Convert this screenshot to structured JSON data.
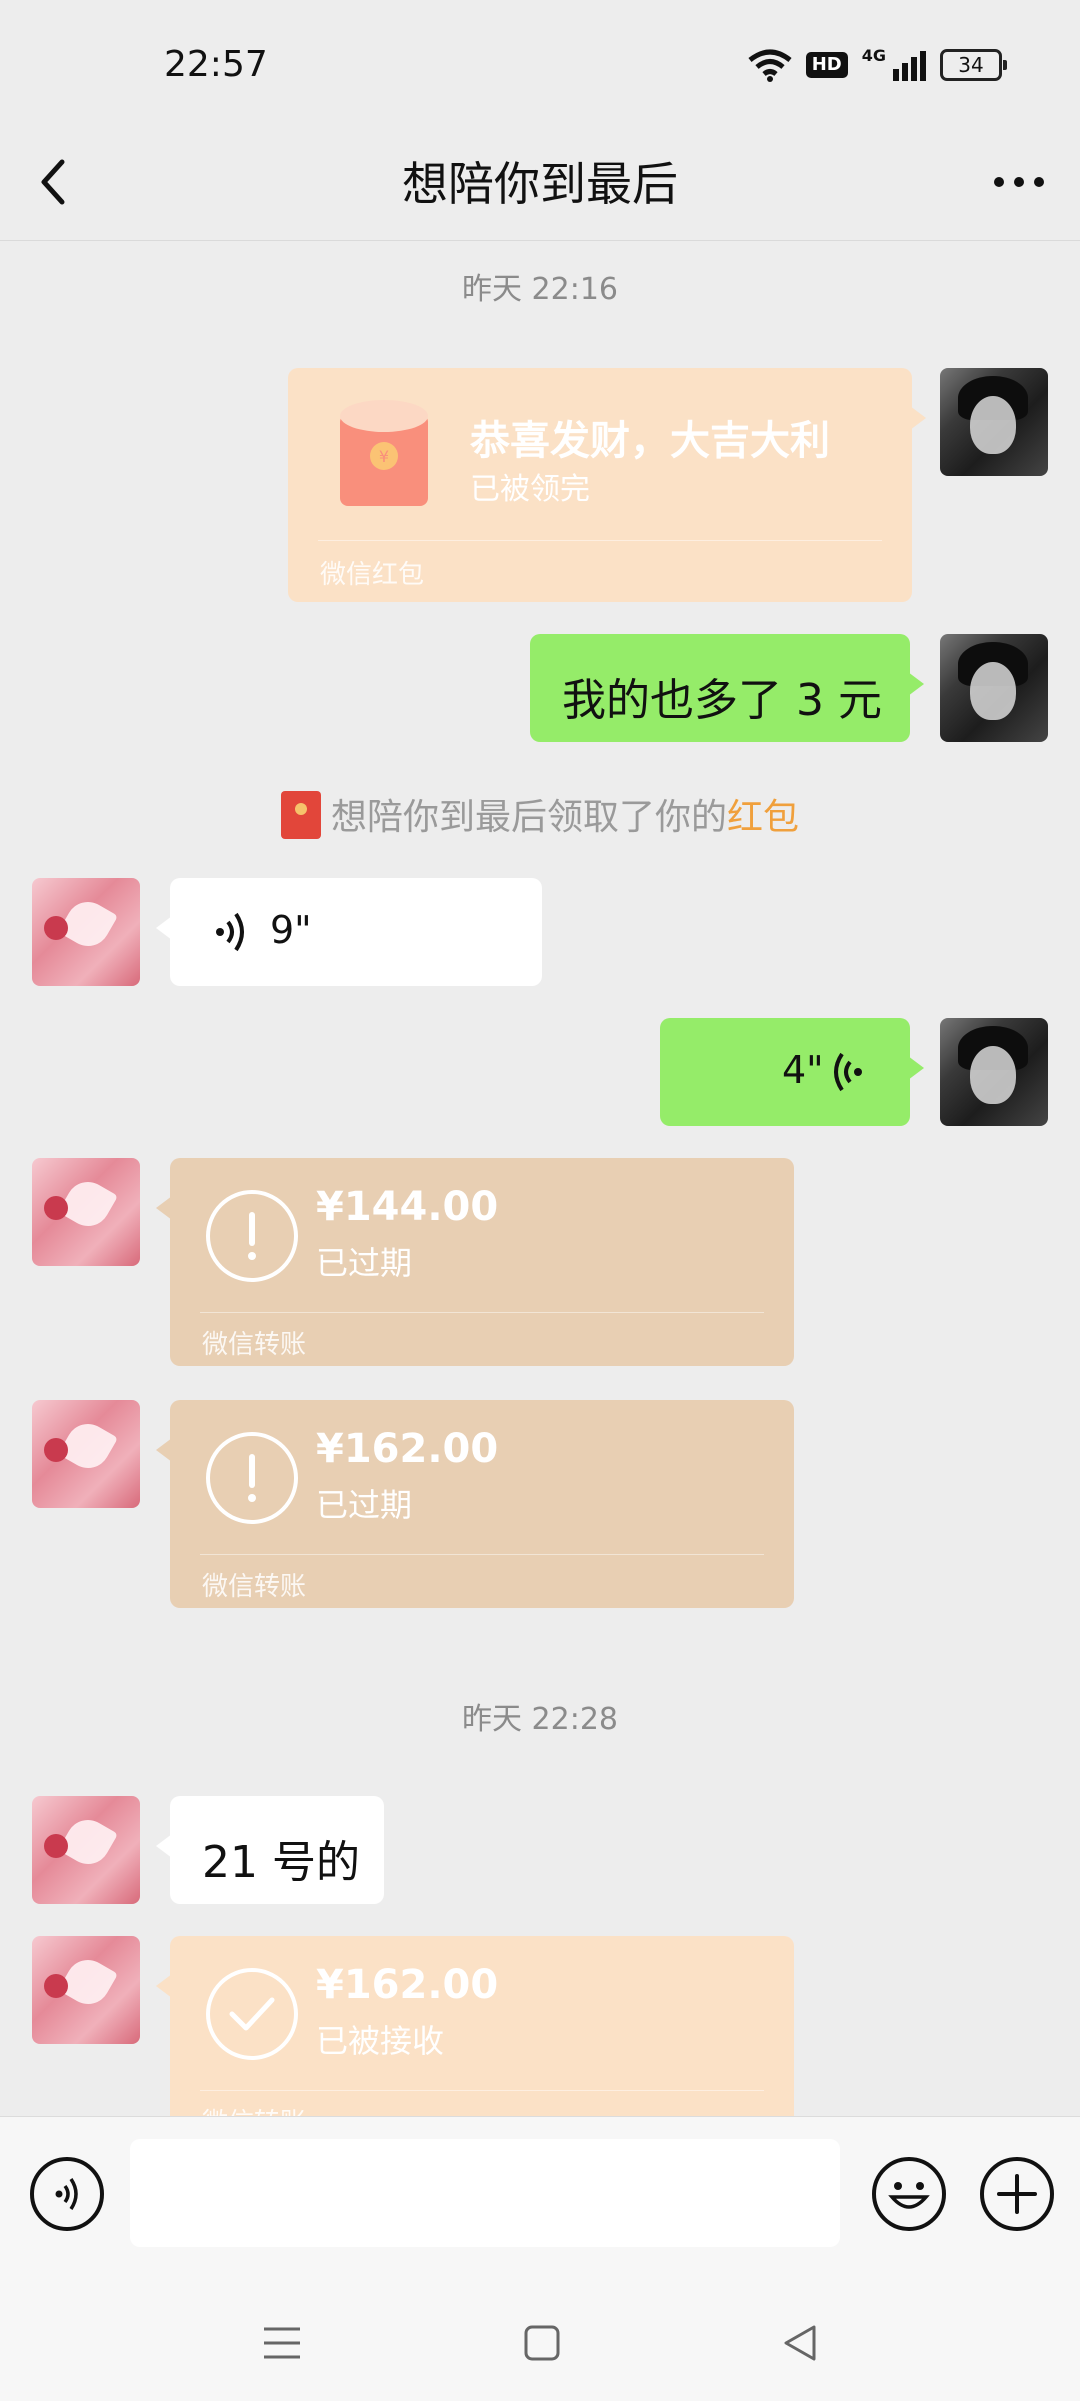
{
  "status_bar": {
    "time": "22:57",
    "hd": "HD",
    "network": "4G",
    "battery": "34"
  },
  "header": {
    "title": "想陪你到最后"
  },
  "messages": {
    "stamp1": "昨天 22:16",
    "redpacket": {
      "title": "恭喜发财，大吉大利",
      "status": "已被领完",
      "footer": "微信红包"
    },
    "me_text": "我的也多了 3 元",
    "system": {
      "prefix": "想陪你到最后领取了你的",
      "highlight": "红包"
    },
    "voice_in": {
      "duration": "9\""
    },
    "voice_out": {
      "duration": "4\""
    },
    "transfer1": {
      "amount": "¥144.00",
      "status": "已过期",
      "footer": "微信转账"
    },
    "transfer2": {
      "amount": "¥162.00",
      "status": "已过期",
      "footer": "微信转账"
    },
    "stamp2": "昨天 22:28",
    "her_text": "21 号的",
    "transfer3": {
      "amount": "¥162.00",
      "status": "已被接收",
      "footer": "微信转账"
    }
  },
  "input_bar": {
    "placeholder": ""
  },
  "colors": {
    "green_bubble": "#95ec69",
    "transfer_expired": "#e8cfb3",
    "transfer_active": "#fbe1c6",
    "redpacket": "#fbe1c6",
    "highlight": "#f0a03c"
  }
}
